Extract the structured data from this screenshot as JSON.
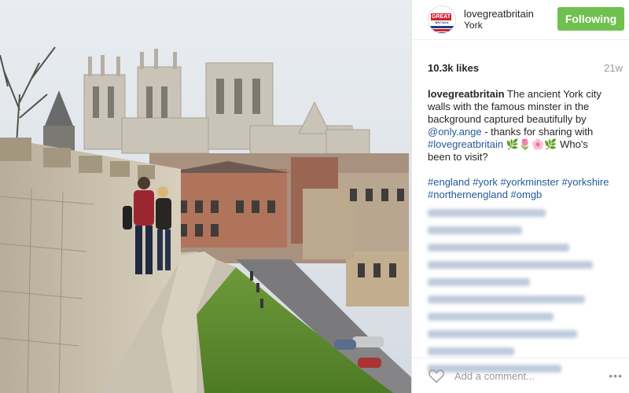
{
  "post": {
    "author": "lovegreatbritain",
    "location": "York",
    "follow_label": "Following",
    "likes": "10.3k likes",
    "age": "21w",
    "avatar": {
      "line1": "GREAT",
      "line2": "BRITAIN"
    },
    "caption": {
      "owner": "lovegreatbritain",
      "text_1": " The ancient York city walls with the famous minster in the background captured beautifully by ",
      "mention": "@only.ange",
      "text_2": " - thanks for sharing with ",
      "hashtag": "#lovegreatbritain",
      "text_3": " 🌿🌷🌸🌿 Who's been to visit?"
    },
    "hashtags_line1": "#england #york #yorkminster #yorkshire",
    "hashtags_line2": "#northernengland #omgb",
    "comment_placeholder": "Add a comment...",
    "more_label": "•••"
  },
  "colors": {
    "follow_bg": "#70c050",
    "link": "#26589a",
    "muted": "#999999"
  },
  "icons": [
    "heart-icon",
    "more-options-icon"
  ]
}
